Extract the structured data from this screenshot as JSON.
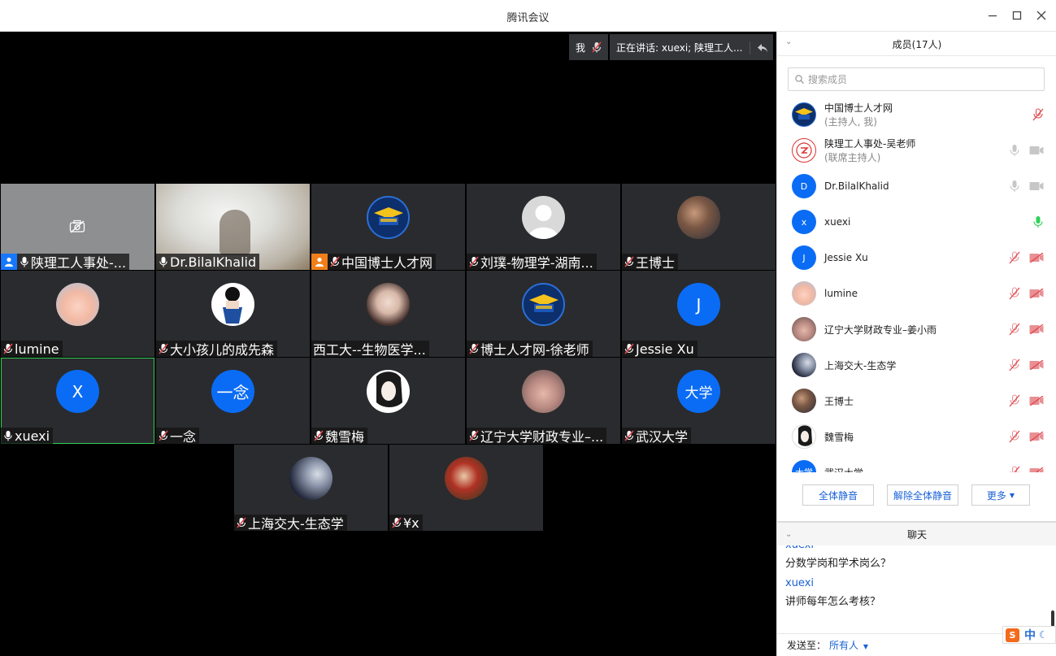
{
  "window": {
    "title": "腾讯会议"
  },
  "top_pills": {
    "me": "我",
    "speaking": "正在讲话: xuexi; 陕理工人..."
  },
  "tiles": [
    {
      "name": "陕理工人事处-...",
      "badge": "host-blue",
      "muted": false,
      "kind": "camera-off"
    },
    {
      "name": "Dr.BilalKhalid",
      "muted": false,
      "kind": "video"
    },
    {
      "name": "中国博士人才网",
      "badge": "host-orange",
      "muted": true,
      "kind": "logo"
    },
    {
      "name": "刘璞-物理学-湖南...",
      "muted": true,
      "kind": "default"
    },
    {
      "name": "王博士",
      "muted": true,
      "kind": "photo"
    },
    {
      "name": "lumine",
      "muted": true,
      "kind": "photo"
    },
    {
      "name": "大小孩儿的成先森",
      "muted": true,
      "kind": "photo"
    },
    {
      "name": "西工大--生物医学...",
      "muted": null,
      "kind": "photo"
    },
    {
      "name": "博士人才网-徐老师",
      "muted": true,
      "kind": "logo"
    },
    {
      "name": "Jessie Xu",
      "muted": true,
      "kind": "letter",
      "letter": "J"
    },
    {
      "name": "xuexi",
      "muted": false,
      "kind": "letter",
      "letter": "X"
    },
    {
      "name": "一念",
      "muted": true,
      "kind": "letter",
      "letter": "一念"
    },
    {
      "name": "魏雪梅",
      "muted": true,
      "kind": "photo"
    },
    {
      "name": "辽宁大学财政专业–...",
      "muted": true,
      "kind": "photo"
    },
    {
      "name": "武汉大学",
      "muted": true,
      "kind": "letter",
      "letter": "大学"
    },
    {
      "name": "上海交大-生态学",
      "muted": true,
      "kind": "photo"
    },
    {
      "name": "¥x",
      "muted": true,
      "kind": "photo"
    }
  ],
  "members": {
    "header": "成员(17人)",
    "search_placeholder": "搜索成员",
    "list": [
      {
        "name": "中国博士人才网",
        "role": "(主持人, 我)",
        "avatar": "logo",
        "mic": "muted-red",
        "cam": "none"
      },
      {
        "name": "陕理工人事处-吴老师",
        "role": "(联席主持人)",
        "avatar": "seal",
        "mic": "gray",
        "cam": "gray"
      },
      {
        "name": "Dr.BilalKhalid",
        "role": "",
        "avatar": "D",
        "mic": "gray",
        "cam": "gray"
      },
      {
        "name": "xuexi",
        "role": "",
        "avatar": "X",
        "mic": "green",
        "cam": "none"
      },
      {
        "name": "Jessie Xu",
        "role": "",
        "avatar": "J",
        "mic": "muted-red",
        "cam": "off-red"
      },
      {
        "name": "lumine",
        "role": "",
        "avatar": "photo",
        "mic": "muted-red",
        "cam": "off-red"
      },
      {
        "name": "辽宁大学财政专业–姜小雨",
        "role": "",
        "avatar": "photo",
        "mic": "muted-red",
        "cam": "off-red"
      },
      {
        "name": "上海交大-生态学",
        "role": "",
        "avatar": "photo",
        "mic": "muted-red",
        "cam": "off-red"
      },
      {
        "name": "王博士",
        "role": "",
        "avatar": "photo",
        "mic": "muted-red",
        "cam": "off-red"
      },
      {
        "name": "魏雪梅",
        "role": "",
        "avatar": "photo",
        "mic": "muted-red",
        "cam": "off-red"
      },
      {
        "name": "武汉大学",
        "role": "",
        "avatar": "大学",
        "mic": "muted-red",
        "cam": "off-red"
      }
    ],
    "btn_mute_all": "全体静音",
    "btn_unmute_all": "解除全体静音",
    "btn_more": "更多"
  },
  "chat": {
    "header": "聊天",
    "messages": [
      {
        "sender": "xuexi",
        "text": "分数学岗和学术岗么？"
      },
      {
        "sender": "xuexi",
        "text": "讲师每年怎么考核？"
      }
    ],
    "send_to_label": "发送至：",
    "send_to_value": "所有人"
  },
  "ime": {
    "lang": "中"
  },
  "colors": {
    "accent": "#0a6cf5",
    "muted": "#e0474c",
    "speaking": "#2fd158",
    "link": "#1a62d6"
  }
}
